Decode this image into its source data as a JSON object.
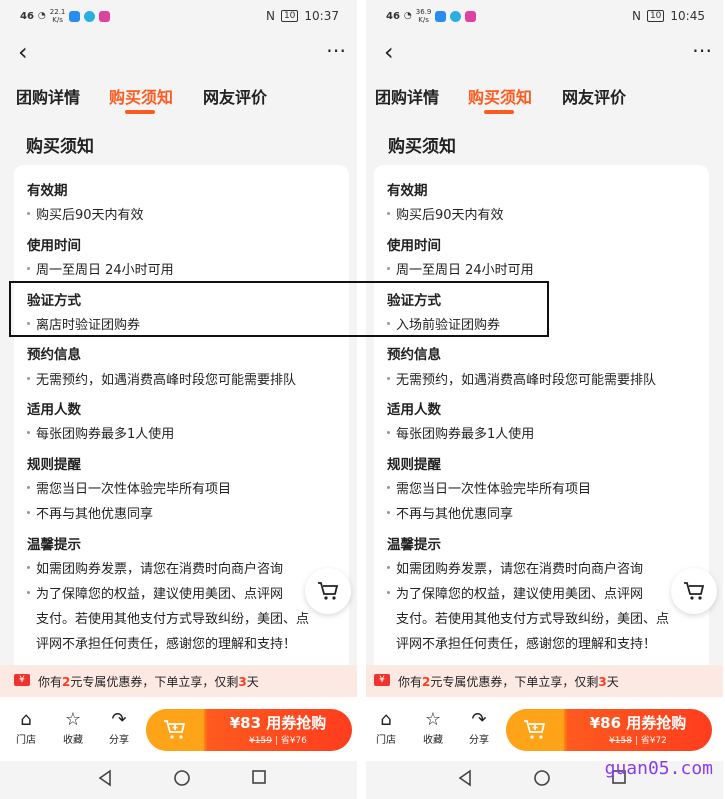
{
  "colors": {
    "accent": "#ff5a1f",
    "promo_bg": "#fde9e4",
    "highlight_box": "#111111",
    "watermark": "#8a3cf0"
  },
  "left": {
    "status": {
      "signal": "46",
      "speed_value": "22.1",
      "speed_unit": "K/s",
      "battery": "10",
      "time": "10:37"
    },
    "tabs": [
      "团购详情",
      "购买须知",
      "网友评价"
    ],
    "active_tab": "购买须知",
    "section_title": "购买须知",
    "rules": [
      {
        "title": "有效期",
        "items": [
          "购买后90天内有效"
        ]
      },
      {
        "title": "使用时间",
        "items": [
          "周一至周日 24小时可用"
        ]
      },
      {
        "title": "验证方式",
        "items": [
          "离店时验证团购券"
        ]
      },
      {
        "title": "预约信息",
        "items": [
          "无需预约，如遇消费高峰时段您可能需要排队"
        ]
      },
      {
        "title": "适用人数",
        "items": [
          "每张团购券最多1人使用"
        ]
      },
      {
        "title": "规则提醒",
        "items": [
          "需您当日一次性体验完毕所有项目",
          "不再与其他优惠同享"
        ]
      },
      {
        "title": "温馨提示",
        "items": [
          "如需团购券发票，请您在消费时向商户咨询",
          "为了保障您的权益，建议使用美团、点评网",
          "支付。若使用其他支付方式导致纠纷，美团、点",
          "评网不承担任何责任，感谢您的理解和支持！"
        ]
      }
    ],
    "promo": {
      "prefix": "你有",
      "amount": "2",
      "middle": "元专属优惠券，下单立享，仅剩",
      "days": "3",
      "suffix": "天"
    },
    "bottom": {
      "store": "门店",
      "favorite": "收藏",
      "share": "分享"
    },
    "buy": {
      "price": "¥83",
      "label": "用券抢购",
      "original": "¥159",
      "save": "省¥76"
    }
  },
  "right": {
    "status": {
      "signal": "46",
      "speed_value": "36.9",
      "speed_unit": "K/s",
      "battery": "10",
      "time": "10:45"
    },
    "tabs": [
      "团购详情",
      "购买须知",
      "网友评价"
    ],
    "active_tab": "购买须知",
    "section_title": "购买须知",
    "rules": [
      {
        "title": "有效期",
        "items": [
          "购买后90天内有效"
        ]
      },
      {
        "title": "使用时间",
        "items": [
          "周一至周日 24小时可用"
        ]
      },
      {
        "title": "验证方式",
        "items": [
          "入场前验证团购券"
        ]
      },
      {
        "title": "预约信息",
        "items": [
          "无需预约，如遇消费高峰时段您可能需要排队"
        ]
      },
      {
        "title": "适用人数",
        "items": [
          "每张团购券最多1人使用"
        ]
      },
      {
        "title": "规则提醒",
        "items": [
          "需您当日一次性体验完毕所有项目",
          "不再与其他优惠同享"
        ]
      },
      {
        "title": "温馨提示",
        "items": [
          "如需团购券发票，请您在消费时向商户咨询",
          "为了保障您的权益，建议使用美团、点评网",
          "支付。若使用其他支付方式导致纠纷，美团、点",
          "评网不承担任何责任，感谢您的理解和支持！"
        ]
      }
    ],
    "promo": {
      "prefix": "你有",
      "amount": "2",
      "middle": "元专属优惠券，下单立享，仅剩",
      "days": "3",
      "suffix": "天"
    },
    "bottom": {
      "store": "门店",
      "favorite": "收藏",
      "share": "分享"
    },
    "buy": {
      "price": "¥86",
      "label": "用券抢购",
      "original": "¥158",
      "save": "省¥72"
    }
  },
  "watermark": "guan05.com"
}
